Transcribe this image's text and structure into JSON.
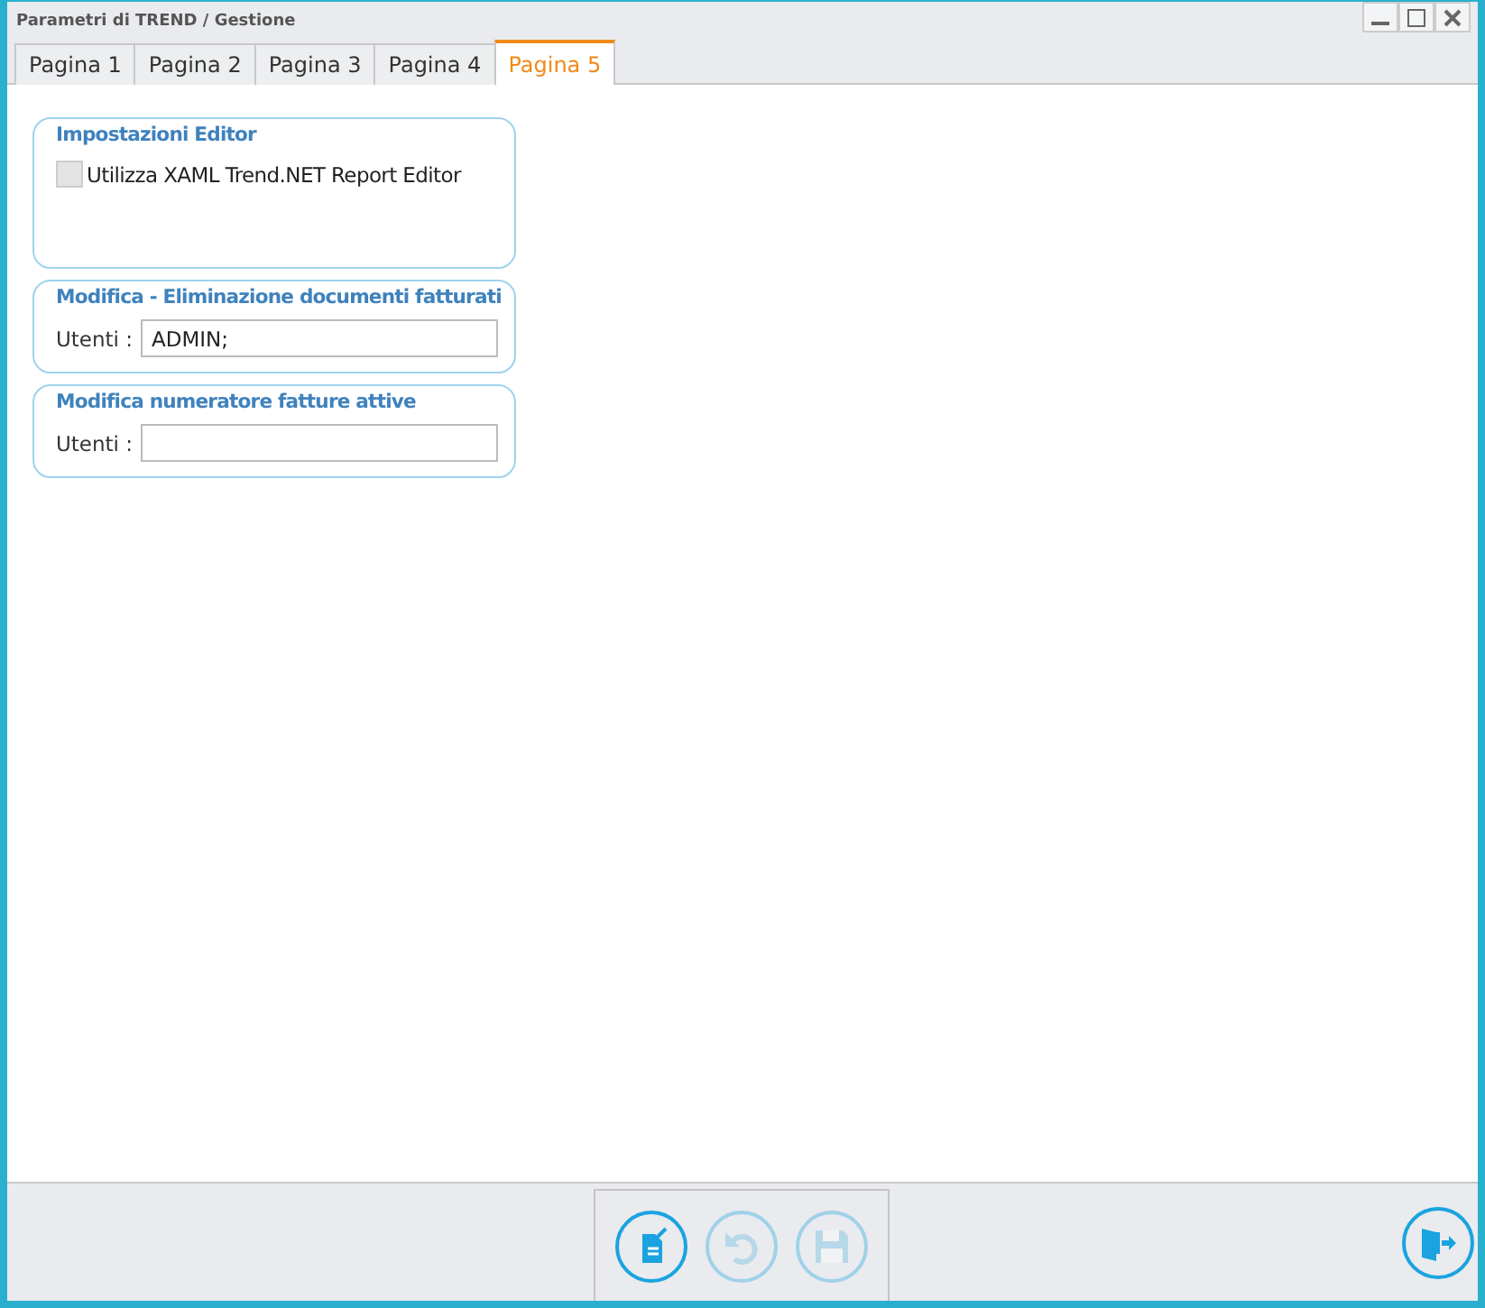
{
  "window": {
    "title": "Parametri di TREND / Gestione"
  },
  "tabs": [
    {
      "label": "Pagina 1",
      "selected": false
    },
    {
      "label": "Pagina 2",
      "selected": false
    },
    {
      "label": "Pagina 3",
      "selected": false
    },
    {
      "label": "Pagina 4",
      "selected": false
    },
    {
      "label": "Pagina 5",
      "selected": true
    }
  ],
  "groups": [
    {
      "kind": "checkbox",
      "title": "Impostazioni Editor",
      "label": "Utilizza XAML Trend.NET Report Editor",
      "checked": false,
      "disabled": true
    },
    {
      "kind": "users",
      "title": "Modifica - Eliminazione documenti fatturati",
      "label": "Utenti :",
      "value": "ADMIN;"
    },
    {
      "kind": "users",
      "title": "Modifica numeratore fatture attive",
      "label": "Utenti :"
    }
  ],
  "toolbar": [
    {
      "kind": "edit",
      "disabled": false
    },
    {
      "kind": "undo",
      "disabled": true
    },
    {
      "kind": "save",
      "disabled": true
    }
  ],
  "exit": {
    "disabled": false
  }
}
